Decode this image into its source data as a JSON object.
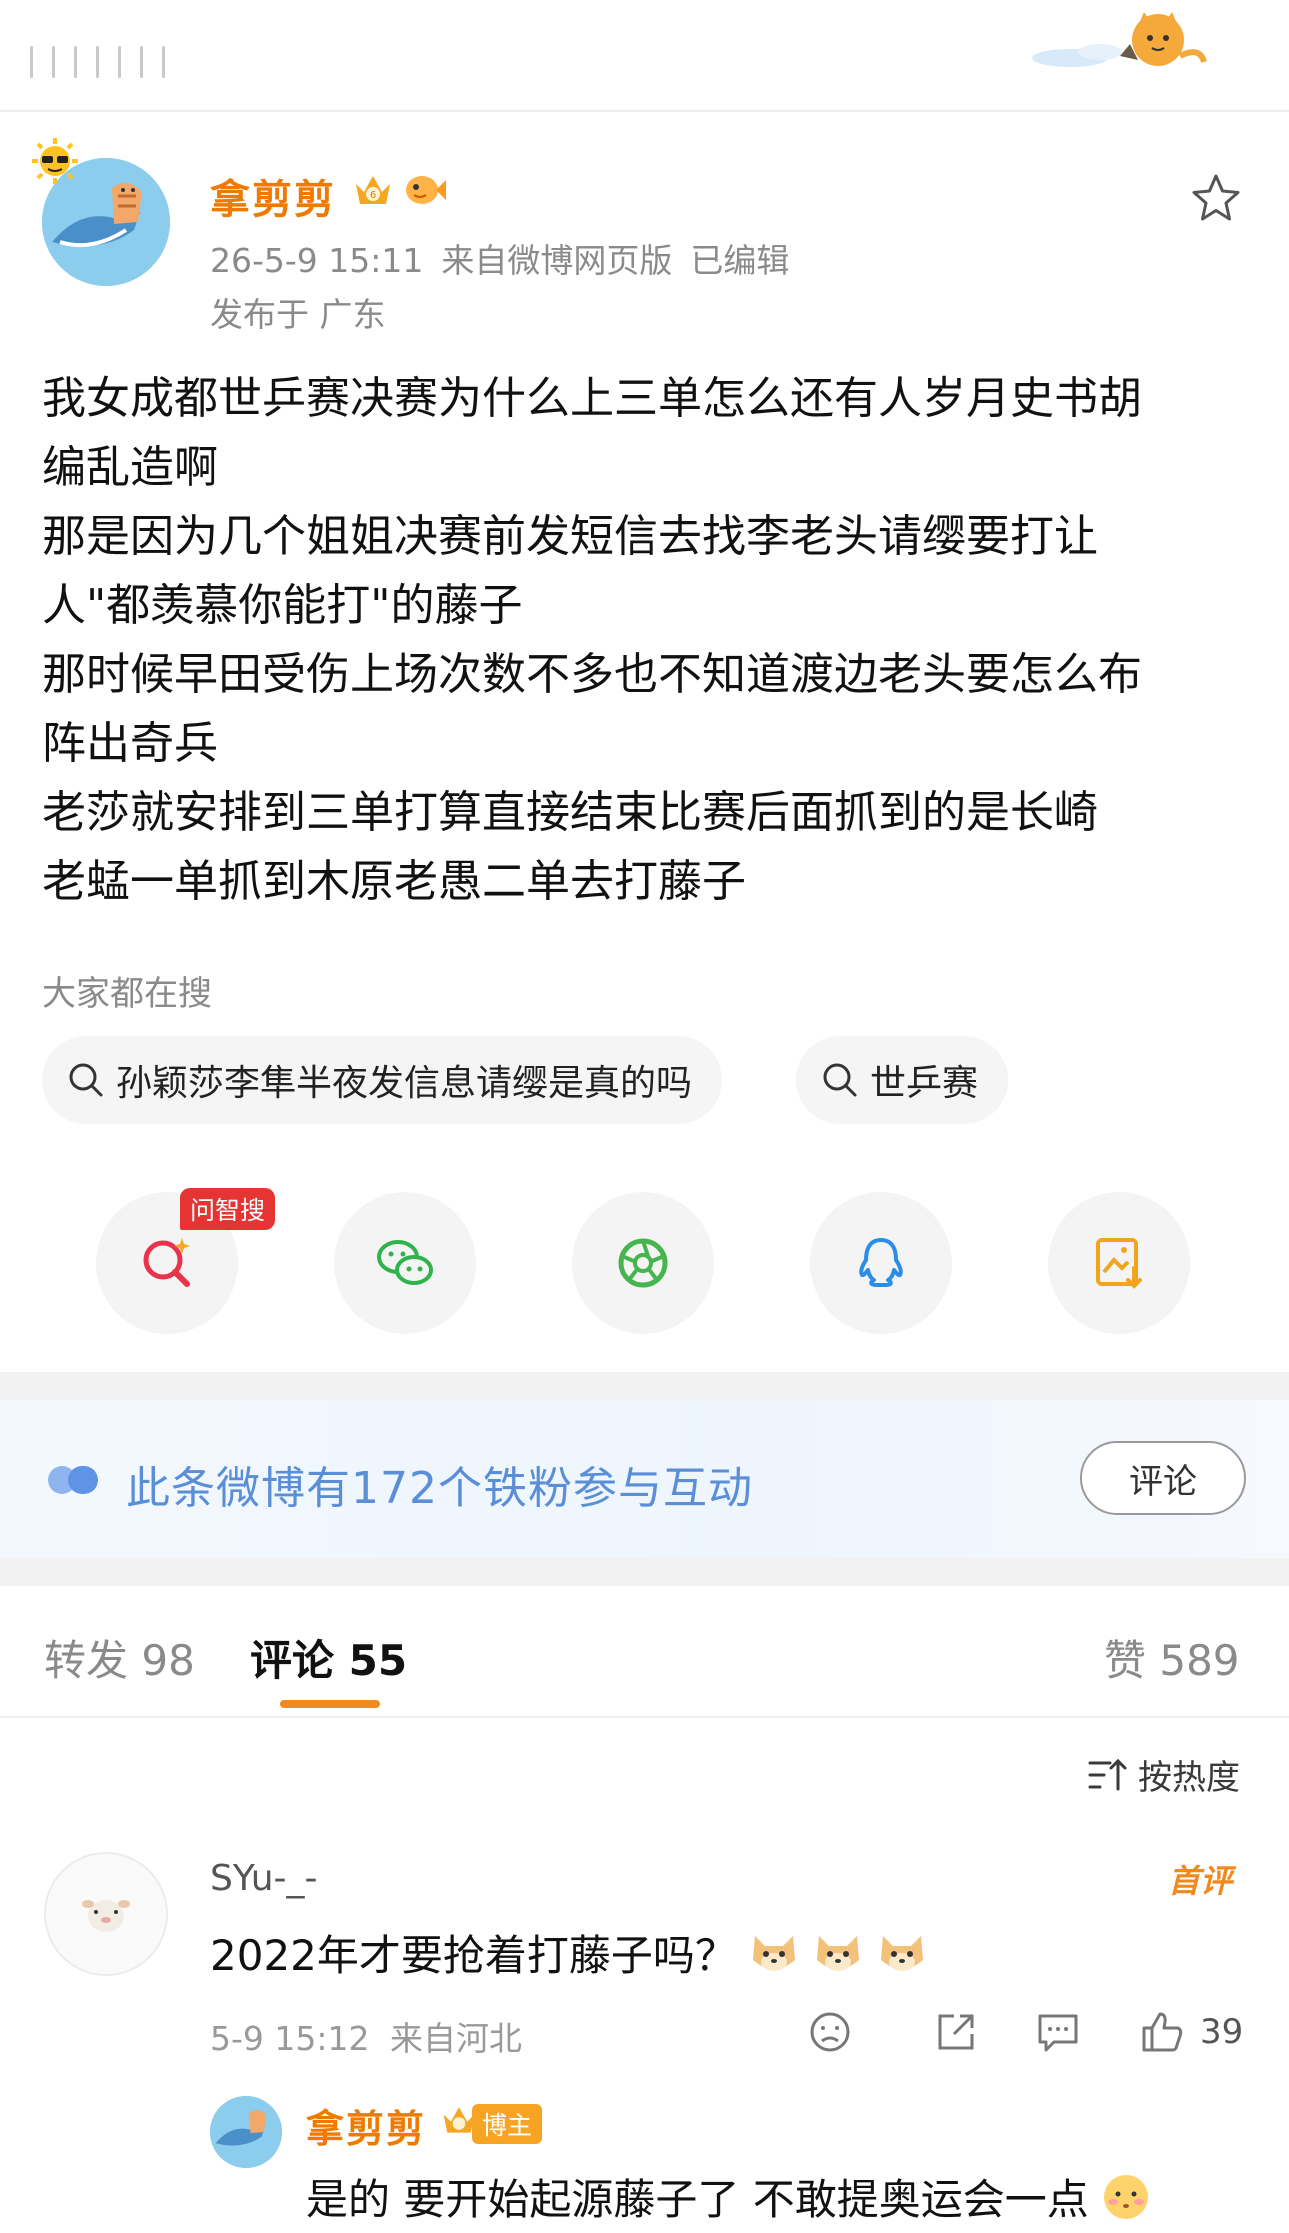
{
  "post": {
    "author": "拿剪剪",
    "timestamp": "26-5-9 15:11",
    "source": "来自微博网页版",
    "edited": "已编辑",
    "location": "发布于 广东",
    "content_lines": [
      "我女成都世乒赛决赛为什么上三单怎么还有人岁月史书胡",
      "编乱造啊",
      "那是因为几个姐姐决赛前发短信去找李老头请缨要打让",
      "人\"都羡慕你能打\"的藤子",
      "那时候早田受伤上场次数不多也不知道渡边老头要怎么布",
      "阵出奇兵",
      "老莎就安排到三单打算直接结束比赛后面抓到的是长崎",
      "老蜢一单抓到木原老愚二单去打藤子"
    ]
  },
  "search": {
    "title": "大家都在搜",
    "items": [
      "孙颖莎李隼半夜发信息请缨是真的吗",
      "世乒赛"
    ]
  },
  "share": {
    "ask_tag": "问智搜",
    "icons": [
      "search-ai-icon",
      "wechat-icon",
      "moments-icon",
      "qq-icon",
      "save-image-icon"
    ]
  },
  "fans": {
    "text": "此条微博有172个铁粉参与互动",
    "button": "评论"
  },
  "tabs": {
    "repost": "转发 98",
    "comment": "评论 55",
    "like": "赞 589",
    "accent": "#f08a1e"
  },
  "sort_label": "按热度",
  "comment": {
    "user": "SYu-_-",
    "badge": "首评",
    "text": "2022年才要抢着打藤子吗？",
    "time": "5-9 15:12",
    "location": "来自河北",
    "likes": "39"
  },
  "reply": {
    "user": "拿剪剪",
    "badge": "博主",
    "text": "是的 要开始起源藤子了 不敢提奥运会一点"
  }
}
